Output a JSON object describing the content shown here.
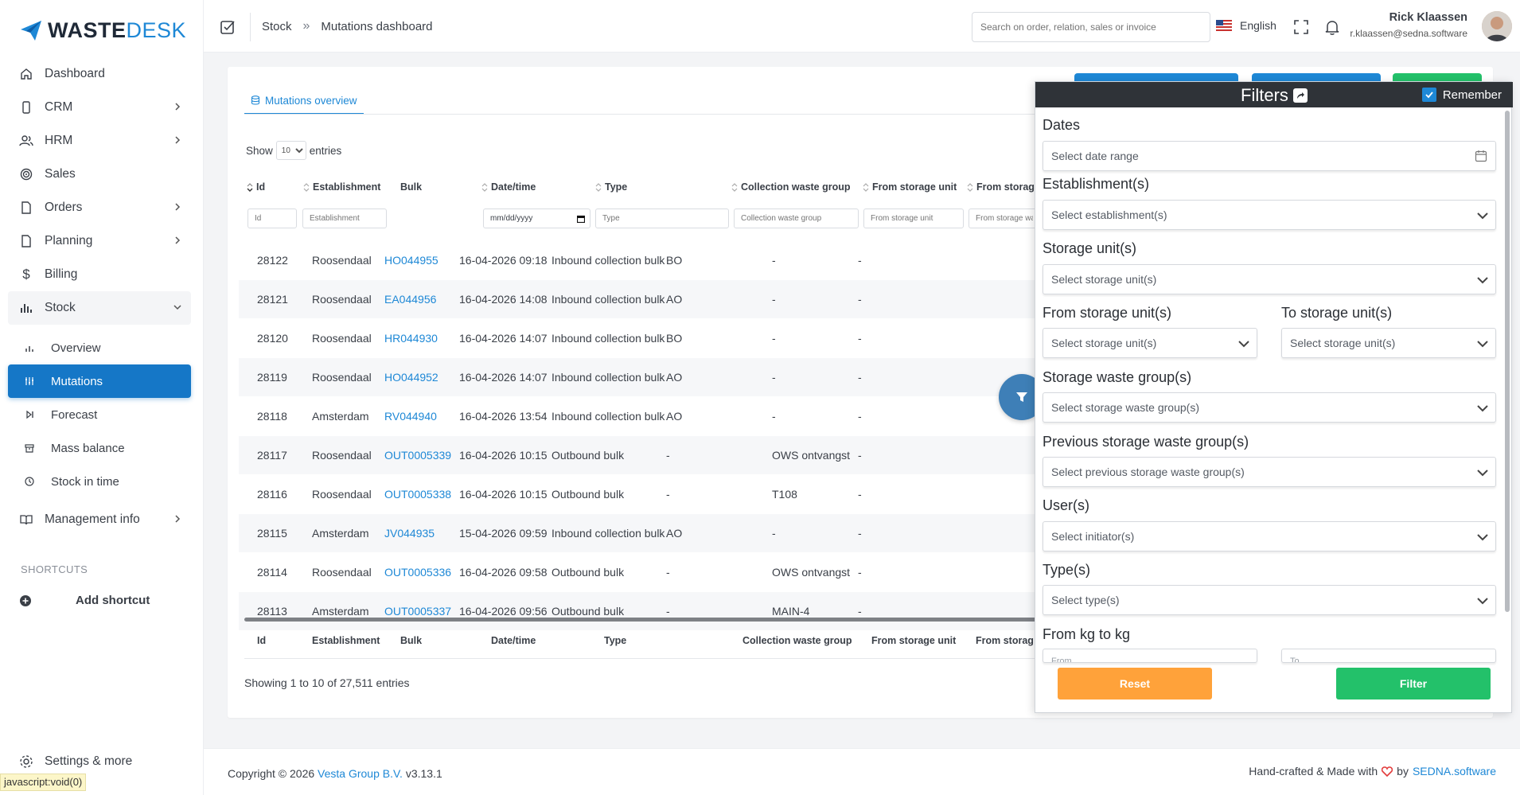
{
  "brand": {
    "name_part1": "WASTE",
    "name_part2": "DESK",
    "accent": "#1e88d6"
  },
  "sidebar": {
    "items": [
      {
        "label": "Dashboard",
        "icon": "home-icon"
      },
      {
        "label": "CRM",
        "icon": "device-icon"
      },
      {
        "label": "HRM",
        "icon": "users-icon"
      },
      {
        "label": "Sales",
        "icon": "target-icon"
      },
      {
        "label": "Orders",
        "icon": "file-icon"
      },
      {
        "label": "Planning",
        "icon": "file-icon"
      },
      {
        "label": "Billing",
        "icon": "dollar-icon"
      },
      {
        "label": "Stock",
        "icon": "bar-chart-icon"
      }
    ],
    "sub_items": [
      {
        "label": "Overview",
        "icon": "bar-chart-icon"
      },
      {
        "label": "Mutations",
        "icon": "sliders-icon"
      },
      {
        "label": "Forecast",
        "icon": "skip-icon"
      },
      {
        "label": "Mass balance",
        "icon": "archive-icon"
      },
      {
        "label": "Stock in time",
        "icon": "clock-icon"
      }
    ],
    "management": "Management info",
    "shortcuts_label": "SHORTCUTS",
    "add_shortcut": "Add shortcut",
    "settings": "Settings & more",
    "status_url": "javascript:void(0)"
  },
  "header": {
    "breadcrumb": [
      "Stock",
      "Mutations dashboard"
    ],
    "breadcrumb_sep": "»",
    "search_placeholder": "Search on order, relation, sales or invoice",
    "language": "English",
    "user_name": "Rick Klaassen",
    "user_email": "r.klaassen@sedna.software"
  },
  "main": {
    "tab": "Mutations overview",
    "show_label": "Show",
    "show_value": "10",
    "entries_label": "entries",
    "columns": [
      "Id",
      "Establishment",
      "Bulk",
      "Date/time",
      "Type",
      "Collection waste group",
      "From storage unit",
      "From storag"
    ],
    "filter_placeholders": [
      "Id",
      "Establishment",
      "mm/dd/yyyy",
      "Type",
      "Collection waste group",
      "From storage unit",
      "From storage wa"
    ],
    "rows": [
      {
        "id": "28122",
        "est": "Roosendaal",
        "bulk": "HO044955",
        "dt": "16-04-2026 09:18",
        "type": "Inbound collection bulk",
        "cwg": "BO",
        "fsu": "-",
        "fsw": "-"
      },
      {
        "id": "28121",
        "est": "Roosendaal",
        "bulk": "EA044956",
        "dt": "16-04-2026 14:08",
        "type": "Inbound collection bulk",
        "cwg": "AO",
        "fsu": "-",
        "fsw": "-"
      },
      {
        "id": "28120",
        "est": "Roosendaal",
        "bulk": "HR044930",
        "dt": "16-04-2026 14:07",
        "type": "Inbound collection bulk",
        "cwg": "BO",
        "fsu": "-",
        "fsw": "-"
      },
      {
        "id": "28119",
        "est": "Roosendaal",
        "bulk": "HO044952",
        "dt": "16-04-2026 14:07",
        "type": "Inbound collection bulk",
        "cwg": "AO",
        "fsu": "-",
        "fsw": "-"
      },
      {
        "id": "28118",
        "est": "Amsterdam",
        "bulk": "RV044940",
        "dt": "16-04-2026 13:54",
        "type": "Inbound collection bulk",
        "cwg": "AO",
        "fsu": "-",
        "fsw": "-"
      },
      {
        "id": "28117",
        "est": "Roosendaal",
        "bulk": "OUT0005339",
        "dt": "16-04-2026 10:15",
        "type": "Outbound bulk",
        "cwg": "-",
        "fsu": "OWS ontvangst",
        "fsw": "-"
      },
      {
        "id": "28116",
        "est": "Roosendaal",
        "bulk": "OUT0005338",
        "dt": "16-04-2026 10:15",
        "type": "Outbound bulk",
        "cwg": "-",
        "fsu": "T108",
        "fsw": "-"
      },
      {
        "id": "28115",
        "est": "Amsterdam",
        "bulk": "JV044935",
        "dt": "15-04-2026 09:59",
        "type": "Inbound collection bulk",
        "cwg": "AO",
        "fsu": "-",
        "fsw": "-"
      },
      {
        "id": "28114",
        "est": "Roosendaal",
        "bulk": "OUT0005336",
        "dt": "16-04-2026 09:58",
        "type": "Outbound bulk",
        "cwg": "-",
        "fsu": "OWS ontvangst",
        "fsw": "-"
      },
      {
        "id": "28113",
        "est": "Amsterdam",
        "bulk": "OUT0005337",
        "dt": "16-04-2026 09:56",
        "type": "Outbound bulk",
        "cwg": "-",
        "fsu": "MAIN-4",
        "fsw": "-"
      }
    ],
    "showing": "Showing 1 to 10 of 27,511 entries"
  },
  "filters": {
    "title": "Filters",
    "remember": "Remember",
    "dates_label": "Dates",
    "dates_placeholder": "Select date range",
    "est_label": "Establishment(s)",
    "est_placeholder": "Select establishment(s)",
    "su_label": "Storage unit(s)",
    "su_placeholder": "Select storage unit(s)",
    "from_su_label": "From storage unit(s)",
    "from_su_placeholder": "Select storage unit(s)",
    "to_su_label": "To storage unit(s)",
    "to_su_placeholder": "Select storage unit(s)",
    "swg_label": "Storage waste group(s)",
    "swg_placeholder": "Select storage waste group(s)",
    "pswg_label": "Previous storage waste group(s)",
    "pswg_placeholder": "Select previous storage waste group(s)",
    "users_label": "User(s)",
    "users_placeholder": "Select initiator(s)",
    "types_label": "Type(s)",
    "types_placeholder": "Select type(s)",
    "kg_label": "From kg to kg",
    "kg_from": "From",
    "kg_to": "To",
    "reset": "Reset",
    "filter": "Filter"
  },
  "footer": {
    "copyright": "Copyright © 2026",
    "company": "Vesta Group B.V.",
    "version": "v3.13.1",
    "crafted": "Hand-crafted & Made with",
    "by": "by",
    "vendor": "SEDNA.software"
  }
}
